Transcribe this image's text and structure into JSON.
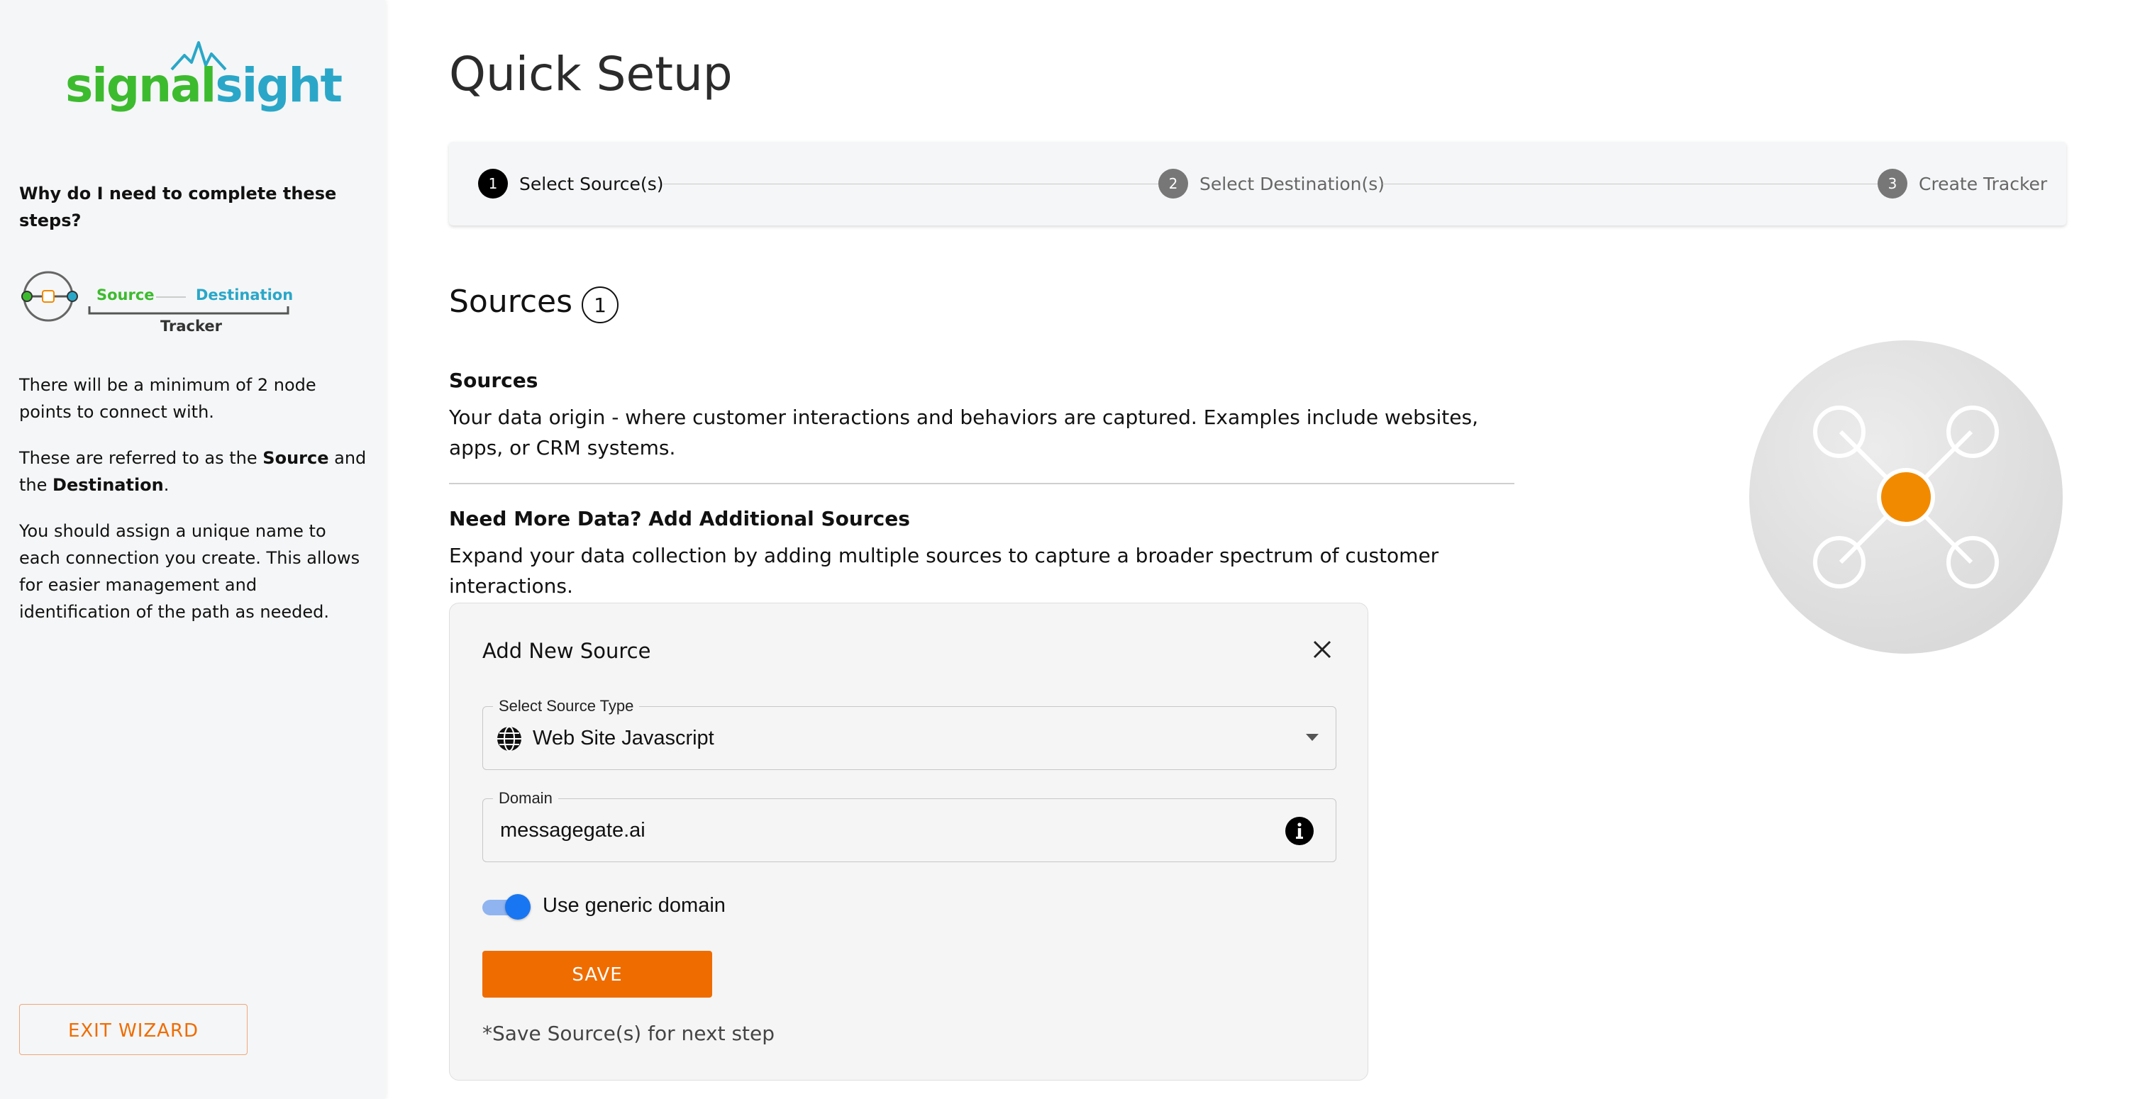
{
  "brand": {
    "part1": "signal",
    "part2": "sight"
  },
  "sidebar": {
    "heading": "Why do I need to complete these steps?",
    "diagram": {
      "source": "Source",
      "destination": "Destination",
      "tracker": "Tracker"
    },
    "p1": "There will be a minimum of 2 node points to connect with.",
    "p2_pre": "These are referred to as the ",
    "p2_source": "Source",
    "p2_mid": " and the ",
    "p2_destination": "Destination",
    "p2_post": ".",
    "p3": "You should assign a unique name to each connection you create. This allows for easier management and identification of the path as needed.",
    "exit_label": "EXIT WIZARD"
  },
  "page": {
    "title": "Quick Setup"
  },
  "stepper": {
    "steps": [
      {
        "num": "1",
        "label": "Select Source(s)",
        "active": true
      },
      {
        "num": "2",
        "label": "Select Destination(s)",
        "active": false
      },
      {
        "num": "3",
        "label": "Create Tracker",
        "active": false
      }
    ]
  },
  "sources": {
    "title": "Sources",
    "count": "1",
    "section1_heading": "Sources",
    "section1_text": "Your data origin - where customer interactions and behaviors are captured. Examples include websites, apps, or CRM systems.",
    "section2_heading": "Need More Data? Add Additional Sources",
    "section2_text": "Expand your data collection by adding multiple sources to capture a broader spectrum of customer interactions."
  },
  "form": {
    "title": "Add New Source",
    "source_type_label": "Select Source Type",
    "source_type_value": "Web Site Javascript",
    "domain_label": "Domain",
    "domain_value": "messagegate.ai",
    "toggle_label": "Use generic domain",
    "toggle_on": true,
    "save_label": "SAVE",
    "note": "*Save Source(s) for next step"
  },
  "colors": {
    "accent": "#ef6c00",
    "toggle": "#1976f2",
    "brand_green": "#3dbb2f",
    "brand_blue": "#2aa7c8",
    "hero_node": "#f28a00"
  },
  "icons": {
    "close": "close-icon",
    "info": "info-icon",
    "globe": "globe-icon",
    "dropdown": "chevron-down-icon"
  }
}
